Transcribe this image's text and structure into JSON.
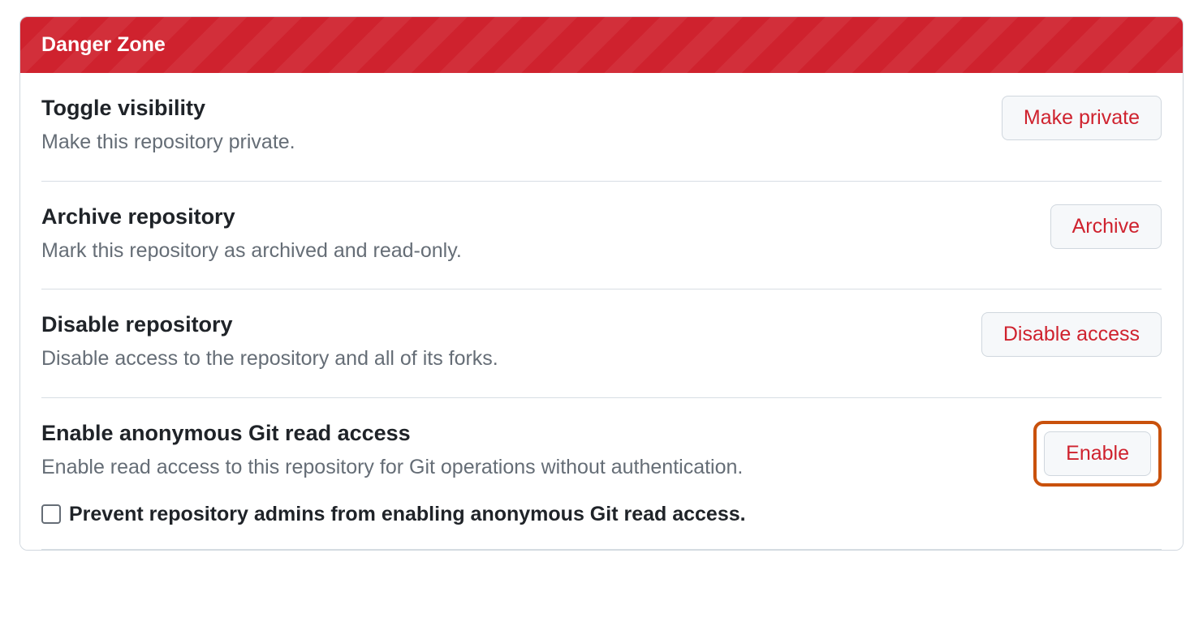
{
  "dangerZone": {
    "header": "Danger Zone",
    "items": [
      {
        "title": "Toggle visibility",
        "desc": "Make this repository private.",
        "button": "Make private"
      },
      {
        "title": "Archive repository",
        "desc": "Mark this repository as archived and read-only.",
        "button": "Archive"
      },
      {
        "title": "Disable repository",
        "desc": "Disable access to the repository and all of its forks.",
        "button": "Disable access"
      },
      {
        "title": "Enable anonymous Git read access",
        "desc": "Enable read access to this repository for Git operations without authentication.",
        "button": "Enable",
        "checkbox": "Prevent repository admins from enabling anonymous Git read access."
      }
    ]
  }
}
